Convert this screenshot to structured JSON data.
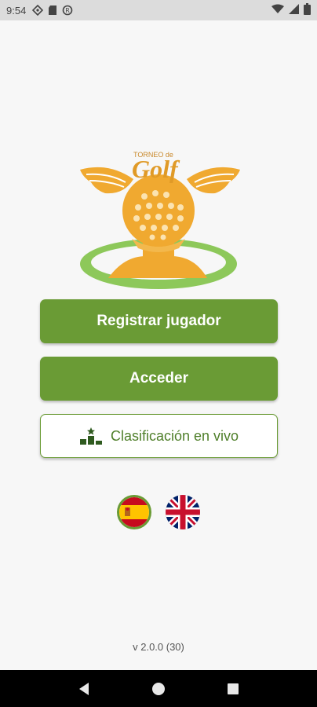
{
  "status_bar": {
    "time": "9:54",
    "icons_left": [
      "location-icon",
      "sd-card-icon",
      "vpn-icon"
    ],
    "icons_right": [
      "wifi-icon",
      "signal-icon",
      "battery-icon"
    ]
  },
  "logo": {
    "line1": "TORNEO de",
    "line2": "Golf",
    "colors": {
      "orange": "#f0a930",
      "green": "#8dc85a"
    }
  },
  "buttons": {
    "register": "Registrar jugador",
    "login": "Acceder",
    "ranking": "Clasificación en vivo",
    "ranking_icon": "podium-icon"
  },
  "languages": [
    "spanish-flag-icon",
    "uk-flag-icon"
  ],
  "version": "v 2.0.0 (30)",
  "nav": [
    "back-icon",
    "home-icon",
    "recents-icon"
  ],
  "colors": {
    "accent": "#6a9b35",
    "background": "#f7f7f7"
  }
}
